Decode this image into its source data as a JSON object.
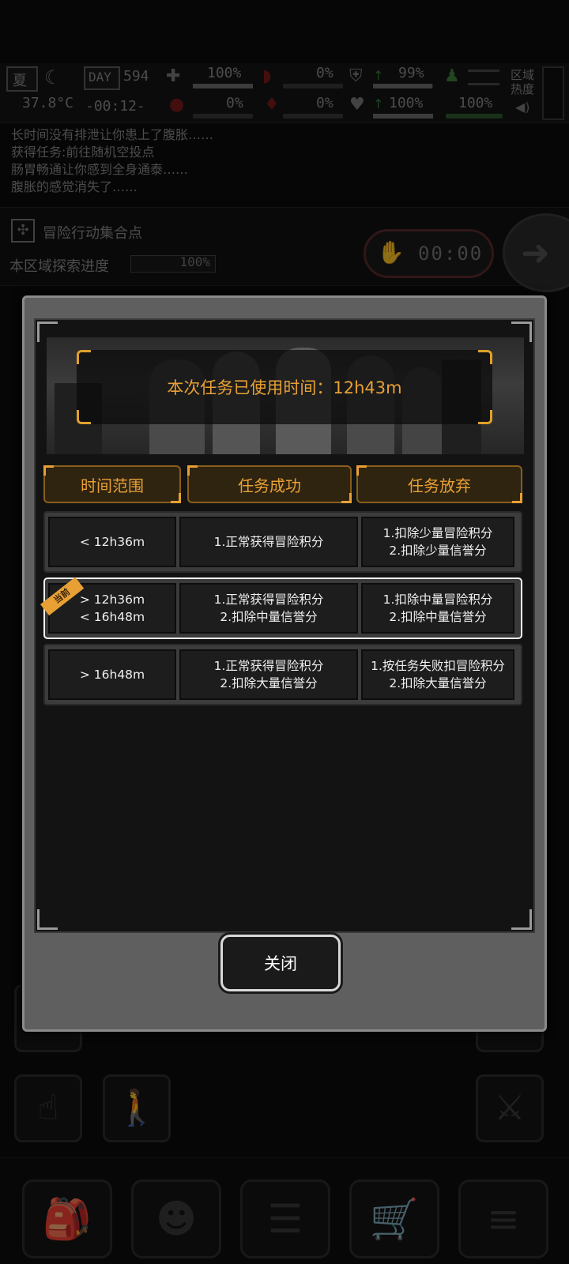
{
  "status": {
    "season": "夏",
    "temperature": "37.8°C",
    "day_badge": "DAY",
    "day_number": "594",
    "clock": "-00:12-",
    "health_pct": "100%",
    "stomach_pct": "0%",
    "blood_pct": "0%",
    "water_pct": "0%",
    "armor_pct": "99%",
    "heart_pct": "100%",
    "mood_pct": "100%",
    "infection_pct": "0%",
    "area_heat_label": "区域热度"
  },
  "log": {
    "lines": [
      "长时间没有排泄让你患上了腹胀……",
      "获得任务:前往随机空投点",
      "肠胃畅通让你感到全身通泰……",
      "腹胀的感觉消失了……"
    ]
  },
  "location": {
    "name": "冒险行动集合点",
    "progress_label": "本区域探索进度",
    "progress_value": "100%",
    "timer": "00:00"
  },
  "modal": {
    "banner_text": "本次任务已使用时间：12h43m",
    "headers": {
      "time_range": "时间范围",
      "success": "任务成功",
      "abandon": "任务放弃"
    },
    "current_tag": "当前",
    "rows": [
      {
        "range": "< 12h36m",
        "success": "1.正常获得冒险积分",
        "abandon": "1.扣除少量冒险积分\n2.扣除少量信誉分",
        "current": false
      },
      {
        "range": "> 12h36m\n< 16h48m",
        "success": "1.正常获得冒险积分\n2.扣除中量信誉分",
        "abandon": "1.扣除中量冒险积分\n2.扣除中量信誉分",
        "current": true
      },
      {
        "range": "> 16h48m",
        "success": "1.正常获得冒险积分\n2.扣除大量信誉分",
        "abandon": "1.按任务失败扣冒险积分\n2.扣除大量信誉分",
        "current": false
      }
    ],
    "close_label": "关闭"
  },
  "colors": {
    "accent": "#e8a035",
    "panel": "#5f5f5f",
    "inner": "#131313"
  },
  "icons": {
    "bottom_left": [
      "drag-hand-icon",
      "walk-icon"
    ],
    "dock": [
      "backpack-icon",
      "brain-icon",
      "journal-icon",
      "cart-icon",
      "menu-list-icon"
    ]
  }
}
